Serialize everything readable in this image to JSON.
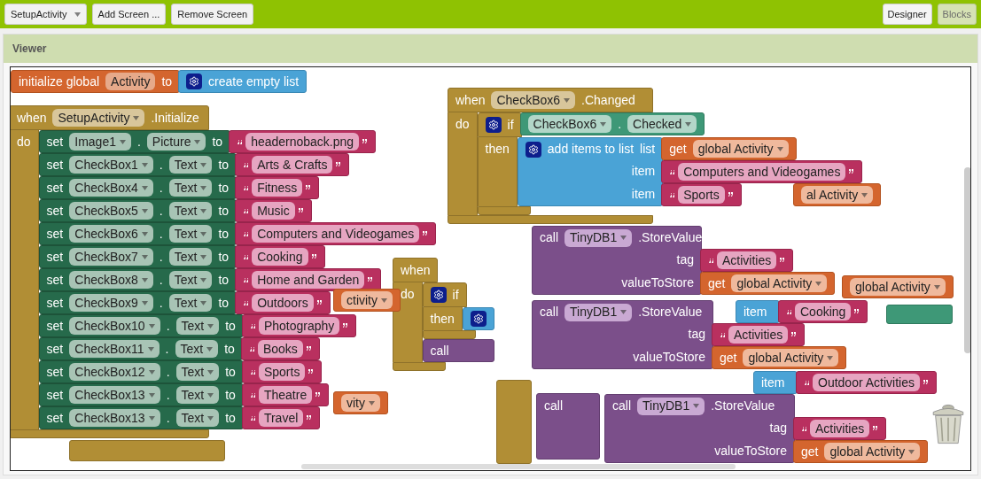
{
  "toolbar": {
    "screen_selector": "SetupActivity",
    "buttons": [
      "Add Screen ...",
      "Remove Screen"
    ],
    "modes": [
      {
        "label": "Designer",
        "selected": false
      },
      {
        "label": "Blocks",
        "selected": true
      }
    ]
  },
  "viewer": {
    "title": "Viewer",
    "blocks": [
      {
        "kind": "init",
        "rows": [
          {
            "parts": [
              {
                "kind": "label",
                "text": "initialize global"
              },
              {
                "kind": "field",
                "text": "Activity"
              },
              {
                "kind": "label",
                "text": "to"
              }
            ],
            "socket": {
              "kind": "list",
              "rows": [
                {
                  "parts": [
                    {
                      "kind": "gear"
                    },
                    {
                      "kind": "label",
                      "text": "create empty list"
                    }
                  ]
                }
              ]
            }
          }
        ]
      },
      {
        "kind": "event",
        "rows": [
          {
            "parts": [
              {
                "kind": "label",
                "text": "when"
              },
              {
                "kind": "dropdown",
                "text": "SetupActivity"
              },
              {
                "kind": "label",
                "text": ".Initialize"
              }
            ]
          }
        ],
        "body": {
          "label": "do",
          "blocks": [
            {
              "kind": "setter",
              "rows": [
                {
                  "parts": [
                    {
                      "kind": "label",
                      "text": "set"
                    },
                    {
                      "kind": "dropdown",
                      "text": "Image1"
                    },
                    {
                      "kind": "label",
                      "text": "."
                    },
                    {
                      "kind": "dropdown",
                      "text": "Picture"
                    },
                    {
                      "kind": "label",
                      "text": "to"
                    }
                  ],
                  "socket": {
                    "kind": "string",
                    "rows": [
                      {
                        "parts": [
                          {
                            "kind": "string",
                            "text": "headernoback.png"
                          }
                        ]
                      }
                    ]
                  }
                }
              ]
            },
            {
              "kind": "setter",
              "rows": [
                {
                  "parts": [
                    {
                      "kind": "label",
                      "text": "set"
                    },
                    {
                      "kind": "dropdown",
                      "text": "CheckBox1"
                    },
                    {
                      "kind": "label",
                      "text": "."
                    },
                    {
                      "kind": "dropdown",
                      "text": "Text"
                    },
                    {
                      "kind": "label",
                      "text": "to"
                    }
                  ],
                  "socket": {
                    "kind": "string",
                    "rows": [
                      {
                        "parts": [
                          {
                            "kind": "string",
                            "text": "Arts & Crafts"
                          }
                        ]
                      }
                    ]
                  }
                }
              ]
            },
            {
              "kind": "setter",
              "rows": [
                {
                  "parts": [
                    {
                      "kind": "label",
                      "text": "set"
                    },
                    {
                      "kind": "dropdown",
                      "text": "CheckBox4"
                    },
                    {
                      "kind": "label",
                      "text": "."
                    },
                    {
                      "kind": "dropdown",
                      "text": "Text"
                    },
                    {
                      "kind": "label",
                      "text": "to"
                    }
                  ],
                  "socket": {
                    "kind": "string",
                    "rows": [
                      {
                        "parts": [
                          {
                            "kind": "string",
                            "text": "Fitness"
                          }
                        ]
                      }
                    ]
                  }
                }
              ]
            },
            {
              "kind": "setter",
              "rows": [
                {
                  "parts": [
                    {
                      "kind": "label",
                      "text": "set"
                    },
                    {
                      "kind": "dropdown",
                      "text": "CheckBox5"
                    },
                    {
                      "kind": "label",
                      "text": "."
                    },
                    {
                      "kind": "dropdown",
                      "text": "Text"
                    },
                    {
                      "kind": "label",
                      "text": "to"
                    }
                  ],
                  "socket": {
                    "kind": "string",
                    "rows": [
                      {
                        "parts": [
                          {
                            "kind": "string",
                            "text": "Music"
                          }
                        ]
                      }
                    ]
                  }
                }
              ]
            },
            {
              "kind": "setter",
              "rows": [
                {
                  "parts": [
                    {
                      "kind": "label",
                      "text": "set"
                    },
                    {
                      "kind": "dropdown",
                      "text": "CheckBox6"
                    },
                    {
                      "kind": "label",
                      "text": "."
                    },
                    {
                      "kind": "dropdown",
                      "text": "Text"
                    },
                    {
                      "kind": "label",
                      "text": "to"
                    }
                  ],
                  "socket": {
                    "kind": "string",
                    "rows": [
                      {
                        "parts": [
                          {
                            "kind": "string",
                            "text": "Computers and Videogames"
                          }
                        ]
                      }
                    ]
                  }
                }
              ]
            },
            {
              "kind": "setter",
              "rows": [
                {
                  "parts": [
                    {
                      "kind": "label",
                      "text": "set"
                    },
                    {
                      "kind": "dropdown",
                      "text": "CheckBox7"
                    },
                    {
                      "kind": "label",
                      "text": "."
                    },
                    {
                      "kind": "dropdown",
                      "text": "Text"
                    },
                    {
                      "kind": "label",
                      "text": "to"
                    }
                  ],
                  "socket": {
                    "kind": "string",
                    "rows": [
                      {
                        "parts": [
                          {
                            "kind": "string",
                            "text": "Cooking"
                          }
                        ]
                      }
                    ]
                  }
                }
              ]
            },
            {
              "kind": "setter",
              "rows": [
                {
                  "parts": [
                    {
                      "kind": "label",
                      "text": "set"
                    },
                    {
                      "kind": "dropdown",
                      "text": "CheckBox8"
                    },
                    {
                      "kind": "label",
                      "text": "."
                    },
                    {
                      "kind": "dropdown",
                      "text": "Text"
                    },
                    {
                      "kind": "label",
                      "text": "to"
                    }
                  ],
                  "socket": {
                    "kind": "string",
                    "rows": [
                      {
                        "parts": [
                          {
                            "kind": "string",
                            "text": "Home and Garden"
                          }
                        ]
                      }
                    ]
                  }
                }
              ]
            },
            {
              "kind": "setter",
              "rows": [
                {
                  "parts": [
                    {
                      "kind": "label",
                      "text": "set"
                    },
                    {
                      "kind": "dropdown",
                      "text": "CheckBox9"
                    },
                    {
                      "kind": "label",
                      "text": "."
                    },
                    {
                      "kind": "dropdown",
                      "text": "Text"
                    },
                    {
                      "kind": "label",
                      "text": "to"
                    }
                  ],
                  "socket": {
                    "kind": "string",
                    "rows": [
                      {
                        "parts": [
                          {
                            "kind": "string",
                            "text": "Outdoors"
                          }
                        ]
                      }
                    ]
                  }
                }
              ]
            },
            {
              "kind": "setter",
              "rows": [
                {
                  "parts": [
                    {
                      "kind": "label",
                      "text": "set"
                    },
                    {
                      "kind": "dropdown",
                      "text": "CheckBox10"
                    },
                    {
                      "kind": "label",
                      "text": "."
                    },
                    {
                      "kind": "dropdown",
                      "text": "Text"
                    },
                    {
                      "kind": "label",
                      "text": "to"
                    }
                  ],
                  "socket": {
                    "kind": "string",
                    "rows": [
                      {
                        "parts": [
                          {
                            "kind": "string",
                            "text": "Photography"
                          }
                        ]
                      }
                    ]
                  }
                }
              ]
            },
            {
              "kind": "setter",
              "rows": [
                {
                  "parts": [
                    {
                      "kind": "label",
                      "text": "set"
                    },
                    {
                      "kind": "dropdown",
                      "text": "CheckBox11"
                    },
                    {
                      "kind": "label",
                      "text": "."
                    },
                    {
                      "kind": "dropdown",
                      "text": "Text"
                    },
                    {
                      "kind": "label",
                      "text": "to"
                    }
                  ],
                  "socket": {
                    "kind": "string",
                    "rows": [
                      {
                        "parts": [
                          {
                            "kind": "string",
                            "text": "Books"
                          }
                        ]
                      }
                    ]
                  }
                }
              ]
            },
            {
              "kind": "setter",
              "rows": [
                {
                  "parts": [
                    {
                      "kind": "label",
                      "text": "set"
                    },
                    {
                      "kind": "dropdown",
                      "text": "CheckBox12"
                    },
                    {
                      "kind": "label",
                      "text": "."
                    },
                    {
                      "kind": "dropdown",
                      "text": "Text"
                    },
                    {
                      "kind": "label",
                      "text": "to"
                    }
                  ],
                  "socket": {
                    "kind": "string",
                    "rows": [
                      {
                        "parts": [
                          {
                            "kind": "string",
                            "text": "Sports"
                          }
                        ]
                      }
                    ]
                  }
                }
              ]
            },
            {
              "kind": "setter",
              "rows": [
                {
                  "parts": [
                    {
                      "kind": "label",
                      "text": "set"
                    },
                    {
                      "kind": "dropdown",
                      "text": "CheckBox13"
                    },
                    {
                      "kind": "label",
                      "text": "."
                    },
                    {
                      "kind": "dropdown",
                      "text": "Text"
                    },
                    {
                      "kind": "label",
                      "text": "to"
                    }
                  ],
                  "socket": {
                    "kind": "string",
                    "rows": [
                      {
                        "parts": [
                          {
                            "kind": "string",
                            "text": "Theatre"
                          }
                        ]
                      }
                    ]
                  }
                }
              ]
            },
            {
              "kind": "setter",
              "rows": [
                {
                  "parts": [
                    {
                      "kind": "label",
                      "text": "set"
                    },
                    {
                      "kind": "dropdown",
                      "text": "CheckBox13"
                    },
                    {
                      "kind": "label",
                      "text": "."
                    },
                    {
                      "kind": "dropdown",
                      "text": "Text"
                    },
                    {
                      "kind": "label",
                      "text": "to"
                    }
                  ],
                  "socket": {
                    "kind": "string",
                    "rows": [
                      {
                        "parts": [
                          {
                            "kind": "string",
                            "text": "Travel"
                          }
                        ]
                      }
                    ]
                  }
                }
              ]
            }
          ]
        }
      },
      {
        "kind": "event",
        "rows": [
          {
            "parts": [
              {
                "kind": "label",
                "text": "when"
              },
              {
                "kind": "dropdown",
                "text": "CheckBox6"
              },
              {
                "kind": "label",
                "text": ".Changed"
              }
            ]
          }
        ],
        "body": {
          "label": "do",
          "blocks": [
            {
              "kind": "control",
              "rows": [
                {
                  "parts": [
                    {
                      "kind": "gear"
                    },
                    {
                      "kind": "label",
                      "text": "if"
                    }
                  ],
                  "socket": {
                    "kind": "component",
                    "rows": [
                      {
                        "parts": [
                          {
                            "kind": "dropdown",
                            "text": "CheckBox6"
                          },
                          {
                            "kind": "label",
                            "text": "."
                          },
                          {
                            "kind": "dropdown",
                            "text": "Checked"
                          }
                        ]
                      }
                    ]
                  }
                }
              ],
              "body": {
                "label": "then",
                "blocks": [
                  {
                    "kind": "list",
                    "rows": [
                      {
                        "parts": [
                          {
                            "kind": "gear"
                          },
                          {
                            "kind": "label",
                            "text": "add items to list"
                          },
                          {
                            "kind": "label",
                            "text": "list"
                          }
                        ],
                        "socket": {
                          "kind": "getter",
                          "rows": [
                            {
                              "parts": [
                                {
                                  "kind": "label",
                                  "text": "get"
                                },
                                {
                                  "kind": "dropdown",
                                  "text": "global Activity"
                                }
                              ]
                            }
                          ]
                        }
                      },
                      {
                        "parts": [
                          {
                            "kind": "label",
                            "text": "item"
                          }
                        ],
                        "socket": {
                          "kind": "string",
                          "rows": [
                            {
                              "parts": [
                                {
                                  "kind": "string",
                                  "text": "Computers and Videogames"
                                }
                              ]
                            }
                          ]
                        }
                      },
                      {
                        "parts": [
                          {
                            "kind": "label",
                            "text": "item"
                          }
                        ],
                        "socket": {
                          "kind": "string",
                          "rows": [
                            {
                              "parts": [
                                {
                                  "kind": "string",
                                  "text": "Sports"
                                }
                              ]
                            }
                          ]
                        }
                      }
                    ]
                  }
                ]
              }
            }
          ]
        }
      },
      {
        "kind": "getter",
        "rows": [
          {
            "parts": [
              {
                "kind": "dropdown",
                "text": "al Activity"
              }
            ]
          }
        ]
      },
      {
        "kind": "call",
        "rows": [
          {
            "parts": [
              {
                "kind": "label",
                "text": "call"
              },
              {
                "kind": "dropdown",
                "text": "TinyDB1"
              },
              {
                "kind": "label",
                "text": ".StoreValue"
              }
            ]
          },
          {
            "parts": [
              {
                "kind": "label",
                "text": "tag"
              }
            ],
            "socket": {
              "kind": "string",
              "rows": [
                {
                  "parts": [
                    {
                      "kind": "string",
                      "text": "Activities"
                    }
                  ]
                }
              ]
            }
          },
          {
            "parts": [
              {
                "kind": "label",
                "text": "valueToStore"
              }
            ],
            "socket": {
              "kind": "getter",
              "rows": [
                {
                  "parts": [
                    {
                      "kind": "label",
                      "text": "get"
                    },
                    {
                      "kind": "dropdown",
                      "text": "global Activity"
                    }
                  ]
                }
              ]
            }
          }
        ]
      },
      {
        "kind": "event",
        "rows": [
          {
            "parts": [
              {
                "kind": "label",
                "text": "when"
              }
            ]
          }
        ],
        "body": {
          "label": "do",
          "blocks": [
            {
              "kind": "control",
              "rows": [
                {
                  "parts": [
                    {
                      "kind": "gear"
                    },
                    {
                      "kind": "label",
                      "text": "if"
                    }
                  ]
                }
              ],
              "body": {
                "label": "then",
                "blocks": [
                  {
                    "kind": "list",
                    "rows": [
                      {
                        "parts": [
                          {
                            "kind": "gear"
                          }
                        ]
                      }
                    ]
                  }
                ]
              }
            },
            {
              "kind": "call",
              "rows": [
                {
                  "parts": [
                    {
                      "kind": "label",
                      "text": "call"
                    }
                  ]
                }
              ]
            }
          ]
        }
      },
      {
        "kind": "getter",
        "rows": [
          {
            "parts": [
              {
                "kind": "dropdown",
                "text": "global Activity"
              }
            ]
          }
        ]
      },
      {
        "kind": "getter",
        "rows": [
          {
            "parts": [
              {
                "kind": "dropdown",
                "text": "ctivity"
              }
            ]
          }
        ]
      },
      {
        "kind": "call",
        "rows": [
          {
            "parts": [
              {
                "kind": "label",
                "text": "call"
              },
              {
                "kind": "dropdown",
                "text": "TinyDB1"
              },
              {
                "kind": "label",
                "text": ".StoreValue"
              }
            ]
          },
          {
            "parts": [
              {
                "kind": "label",
                "text": "tag"
              }
            ],
            "socket": {
              "kind": "string",
              "rows": [
                {
                  "parts": [
                    {
                      "kind": "string",
                      "text": "Activities"
                    }
                  ]
                }
              ]
            }
          },
          {
            "parts": [
              {
                "kind": "label",
                "text": "valueToStore"
              }
            ],
            "socket": {
              "kind": "getter",
              "rows": [
                {
                  "parts": [
                    {
                      "kind": "label",
                      "text": "get"
                    },
                    {
                      "kind": "dropdown",
                      "text": "global Activity"
                    }
                  ]
                }
              ]
            }
          }
        ]
      },
      {
        "kind": "list",
        "rows": [
          {
            "parts": [
              {
                "kind": "label",
                "text": "item"
              }
            ],
            "socket": {
              "kind": "string",
              "rows": [
                {
                  "parts": [
                    {
                      "kind": "string",
                      "text": "Cooking"
                    }
                  ]
                }
              ]
            }
          }
        ]
      },
      {
        "kind": "component"
      },
      {
        "kind": "list",
        "rows": [
          {
            "parts": [
              {
                "kind": "label",
                "text": "item"
              }
            ],
            "socket": {
              "kind": "string",
              "rows": [
                {
                  "parts": [
                    {
                      "kind": "string",
                      "text": "Outdoor Activities"
                    }
                  ]
                }
              ]
            }
          }
        ]
      },
      {
        "kind": "event"
      },
      {
        "kind": "getter",
        "rows": [
          {
            "parts": [
              {
                "kind": "dropdown",
                "text": "vity"
              }
            ]
          }
        ]
      },
      {
        "kind": "call",
        "rows": [
          {
            "parts": [
              {
                "kind": "label",
                "text": "call"
              }
            ]
          }
        ]
      },
      {
        "kind": "call",
        "rows": [
          {
            "parts": [
              {
                "kind": "label",
                "text": "call"
              },
              {
                "kind": "dropdown",
                "text": "TinyDB1"
              },
              {
                "kind": "label",
                "text": ".StoreValue"
              }
            ]
          },
          {
            "parts": [
              {
                "kind": "label",
                "text": "tag"
              }
            ],
            "socket": {
              "kind": "string",
              "rows": [
                {
                  "parts": [
                    {
                      "kind": "string",
                      "text": "Activities"
                    }
                  ]
                }
              ]
            }
          },
          {
            "parts": [
              {
                "kind": "label",
                "text": "valueToStore"
              }
            ],
            "socket": {
              "kind": "getter",
              "rows": [
                {
                  "parts": [
                    {
                      "kind": "label",
                      "text": "get"
                    },
                    {
                      "kind": "dropdown",
                      "text": "global Activity"
                    }
                  ]
                }
              ]
            }
          }
        ]
      },
      {
        "kind": "event"
      }
    ]
  }
}
